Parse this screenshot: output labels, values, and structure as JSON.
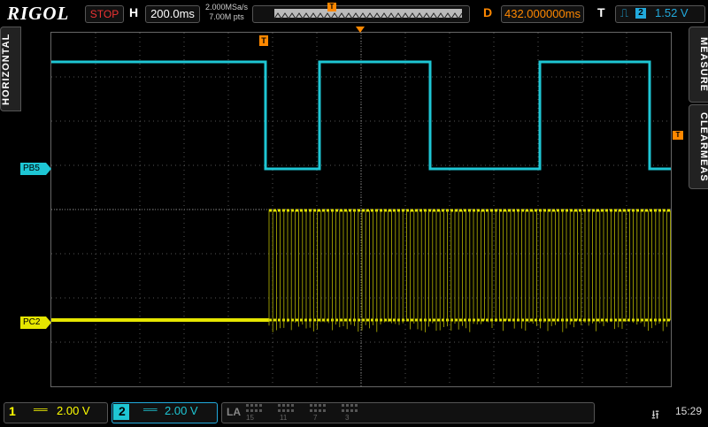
{
  "header": {
    "brand": "RIGOL",
    "run_state": "STOP",
    "h_label": "H",
    "timebase": "200.0ms",
    "sample_rate": "2.000MSa/s",
    "points": "7.00M pts",
    "d_label": "D",
    "delay": "432.000000ms",
    "t_label": "T",
    "trigger_source": "2",
    "trigger_level": "1.52 V"
  },
  "side_tabs": {
    "left": "HORIZONTAL",
    "right_top": "MEASURE",
    "right_bottom": "CLEARMEAS"
  },
  "markers": {
    "trigger_pos": "T",
    "trigger_level": "T"
  },
  "channels": {
    "pb5": {
      "label": "PB5",
      "color": "#1ec6d4"
    },
    "pc2": {
      "label": "PC2",
      "color": "#e6e600"
    }
  },
  "footer": {
    "ch1": {
      "num": "1",
      "coupling": "══",
      "scale": "2.00 V",
      "color": "#ffff00"
    },
    "ch2": {
      "num": "2",
      "coupling": "══",
      "scale": "2.00 V",
      "color": "#1ec6d4"
    },
    "la": {
      "label": "LA",
      "digits_top": "15",
      "digits_mid1": "11",
      "digits_mid2": "7",
      "digits_end": "3"
    },
    "usb_icon": "usb-icon",
    "time": "15:29"
  },
  "waveforms": {
    "pb5_levels": [
      "high",
      "low",
      "high",
      "low",
      "high",
      "low"
    ],
    "pc2_burst": true
  }
}
